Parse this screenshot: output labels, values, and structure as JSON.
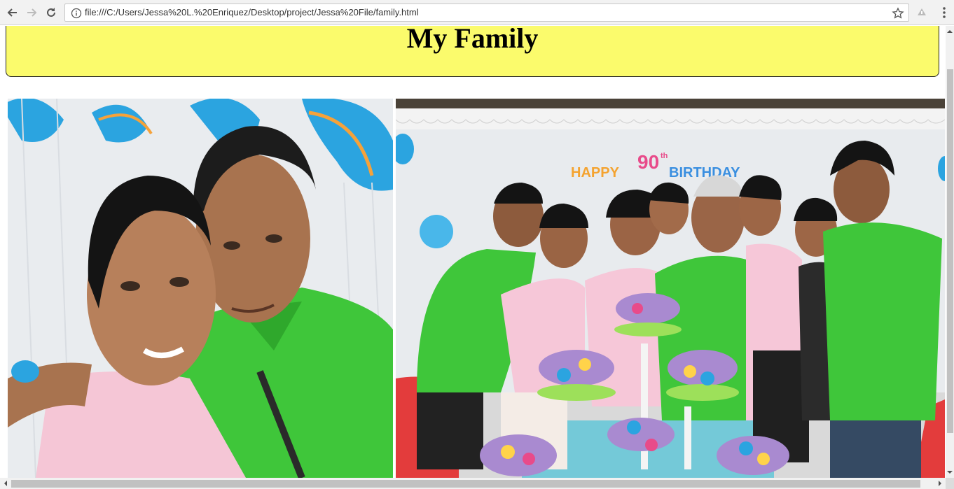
{
  "browser": {
    "url": "file:///C:/Users/Jessa%20L.%20Enriquez/Desktop/project/Jessa%20File/family.html",
    "icons": [
      "back-icon",
      "forward-icon",
      "reload-icon",
      "info-icon",
      "star-icon",
      "extension-icon",
      "menu-icon"
    ]
  },
  "page": {
    "heading": "My Family",
    "header_color": "#fbfb6c"
  },
  "photos": [
    {
      "name": "couple-photo",
      "description_visible": ""
    },
    {
      "name": "birthday-group-photo",
      "banner_number": "90",
      "banner_suffix": "th",
      "banner_text": "HAPPY BIRTHDAY"
    }
  ]
}
